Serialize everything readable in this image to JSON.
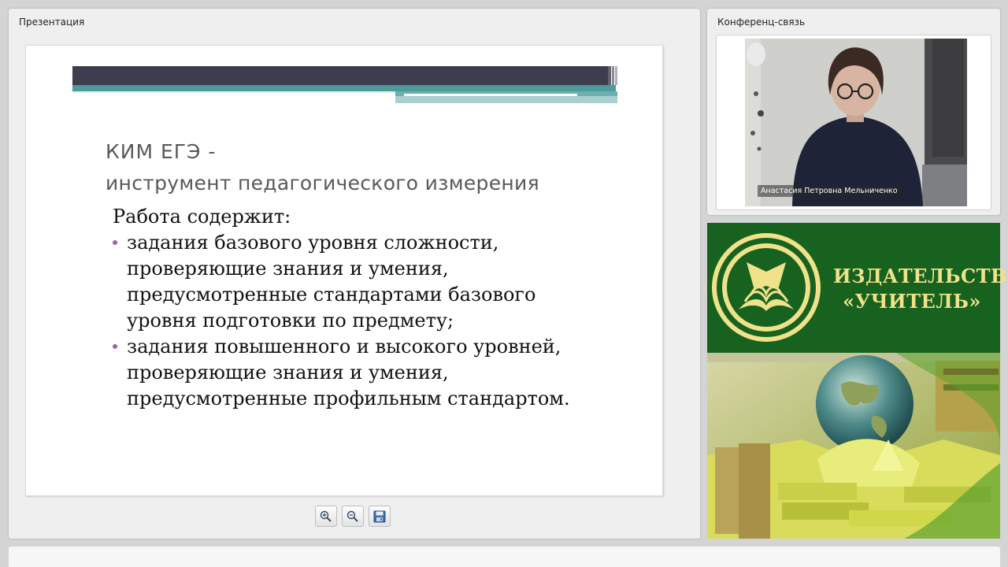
{
  "presentation_panel": {
    "title": "Презентация",
    "slide": {
      "heading_line1": "КИМ  ЕГЭ -",
      "heading_line2": "инструмент педагогического измерения",
      "lead": "Работа содержит:",
      "bullets": [
        {
          "lines": [
            "задания  базового уровня  сложности,",
            "проверяющие  знания  и  умения,",
            "предусмотренные  стандартами  базового",
            "уровня  подготовки  по  предмету;"
          ]
        },
        {
          "lines": [
            "задания повышенного  и  высокого  уровней,",
            "проверяющие  знания  и  умения,",
            "предусмотренные  профильным  стандартом."
          ]
        }
      ],
      "bullet_color": "#a060a8",
      "heading_color": "#595959"
    },
    "toolbar": {
      "zoom_in_icon": "zoom-in-icon",
      "zoom_out_icon": "zoom-out-icon",
      "save_icon": "save-icon"
    }
  },
  "conference_panel": {
    "title": "Конференц-связь",
    "participant_name": "Анастасия Петровна Мельниченко"
  },
  "banner": {
    "line1": "ИЗДАТЕЛЬСТВО",
    "line2": "«УЧИТЕЛЬ»",
    "background": "#17621f",
    "text_color": "#f0e28a"
  }
}
